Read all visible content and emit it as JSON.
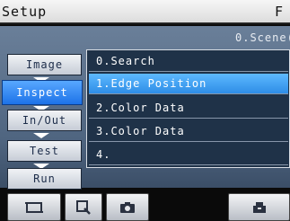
{
  "title_bar": {
    "title": "Setup",
    "right_fragment": "F"
  },
  "scene_label": "0.Scene(",
  "side_menu": [
    {
      "label": "Image",
      "active": false
    },
    {
      "label": "Inspect",
      "active": true
    },
    {
      "label": "In/Out",
      "active": false
    },
    {
      "label": "Test",
      "active": false
    },
    {
      "label": "Run",
      "active": false
    }
  ],
  "item_list": [
    {
      "label": "0.Search",
      "selected": false
    },
    {
      "label": "1.Edge Position",
      "selected": true
    },
    {
      "label": "2.Color Data",
      "selected": false
    },
    {
      "label": "3.Color Data",
      "selected": false
    },
    {
      "label": "4.",
      "selected": false
    }
  ],
  "toolbar": {
    "buttons": [
      {
        "icon": "display-icon"
      },
      {
        "icon": "zoom-icon"
      },
      {
        "icon": "camera-icon"
      },
      {
        "icon": "save-icon"
      }
    ]
  },
  "colors": {
    "active_blue": "#1d72e8",
    "selected_row": "#2e8de6",
    "panel": "#4f6580"
  }
}
